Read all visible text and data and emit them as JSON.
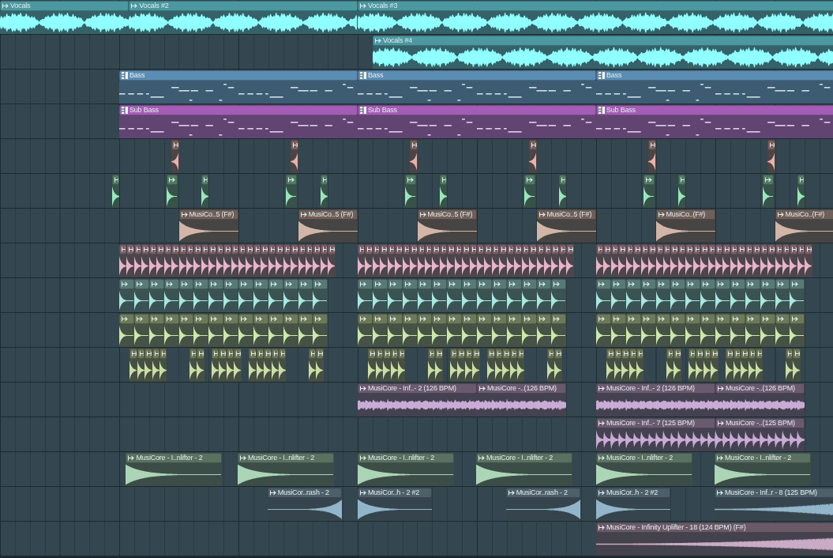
{
  "playlist": {
    "tracks": [
      {
        "color": "#4b98a0",
        "clips": [
          {
            "kind": "vocal",
            "label": "Vocals"
          },
          {
            "kind": "vocal",
            "label": "Vocals #2"
          },
          {
            "kind": "vocal",
            "label": "Vocals #3"
          }
        ]
      },
      {
        "color": "#4b98a0",
        "clips": [
          {
            "kind": "vocal",
            "label": "Vocals #4"
          }
        ]
      },
      {
        "color": "#5b8db3",
        "clips": [
          {
            "kind": "pattern",
            "label": "Bass"
          },
          {
            "kind": "pattern",
            "label": "Bass"
          },
          {
            "kind": "pattern",
            "label": "Bass"
          }
        ]
      },
      {
        "color": "#a35db4",
        "clips": [
          {
            "kind": "pattern",
            "label": "Sub Bass"
          },
          {
            "kind": "pattern",
            "label": "Sub Bass"
          },
          {
            "kind": "pattern",
            "label": "Sub Bass"
          }
        ]
      },
      {
        "color": "#7a5d5a",
        "clips": [
          {
            "kind": "swell"
          },
          {
            "kind": "swell"
          },
          {
            "kind": "swell"
          },
          {
            "kind": "swell"
          },
          {
            "kind": "swell"
          },
          {
            "kind": "swell"
          }
        ]
      },
      {
        "color": "#4f7a62",
        "clips": [
          {
            "kind": "decay"
          },
          {
            "kind": "decay"
          },
          {
            "kind": "decay"
          },
          {
            "kind": "decay"
          },
          {
            "kind": "decay"
          },
          {
            "kind": "decay"
          },
          {
            "kind": "decay"
          },
          {
            "kind": "decay"
          },
          {
            "kind": "decay"
          },
          {
            "kind": "decay"
          },
          {
            "kind": "decay"
          },
          {
            "kind": "decay"
          },
          {
            "kind": "decay"
          }
        ]
      },
      {
        "color": "#6e5f58",
        "clips": [
          {
            "kind": "decay",
            "label": "MusiCo..5 (F#)"
          },
          {
            "kind": "decay",
            "label": "MusiCo..5 (F#)"
          },
          {
            "kind": "decay",
            "label": "MusiCo..5 (F#)"
          },
          {
            "kind": "decay",
            "label": "MusiCo..5 (F#)"
          },
          {
            "kind": "decay",
            "label": "MusiCo..(F#)"
          },
          {
            "kind": "decay",
            "label": "MusiCo..(F#)"
          }
        ]
      },
      {
        "color": "#7a5f68",
        "clips": [
          {
            "kind": "stutter"
          },
          {
            "kind": "stutter"
          },
          {
            "kind": "stutter"
          }
        ]
      },
      {
        "color": "#587a76",
        "clips": [
          {
            "kind": "hits"
          },
          {
            "kind": "hits"
          },
          {
            "kind": "hits"
          }
        ]
      },
      {
        "color": "#6c7a5a",
        "clips": [
          {
            "kind": "hits"
          },
          {
            "kind": "hits"
          },
          {
            "kind": "hits"
          }
        ]
      },
      {
        "color": "#6b7556",
        "clips": [
          {
            "kind": "stutter"
          },
          {
            "kind": "stutter"
          },
          {
            "kind": "stutter"
          },
          {
            "kind": "stutter"
          },
          {
            "kind": "stutter"
          },
          {
            "kind": "stutter"
          },
          {
            "kind": "stutter"
          },
          {
            "kind": "stutter"
          },
          {
            "kind": "stutter"
          },
          {
            "kind": "stutter"
          },
          {
            "kind": "stutter"
          },
          {
            "kind": "stutter"
          },
          {
            "kind": "stutter"
          },
          {
            "kind": "stutter"
          },
          {
            "kind": "stutter"
          }
        ]
      },
      {
        "color": "#6a5a70",
        "clips": [
          {
            "kind": "noise",
            "label": "MusiCore - Inf..- 2 (126 BPM)"
          },
          {
            "kind": "noise",
            "label": "MusiCore -..(126 BPM)"
          },
          {
            "kind": "noise",
            "label": "MusiCore - Inf..- 2 (126 BPM)"
          },
          {
            "kind": "noise",
            "label": "MusiCore -..(126 BPM)"
          }
        ]
      },
      {
        "color": "#6a5a70",
        "clips": [
          {
            "kind": "pulse",
            "label": "MusiCore - Inf..- 7 (125 BPM)"
          },
          {
            "kind": "pulse",
            "label": "MusiCore -..(125 BPM)"
          }
        ]
      },
      {
        "color": "#5a7060",
        "clips": [
          {
            "kind": "decay",
            "label": "MusiCore - I..nlifter - 2"
          },
          {
            "kind": "decay",
            "label": "MusiCore - I..nlifter - 2"
          },
          {
            "kind": "decay",
            "label": "MusiCore - I..nlifter - 2"
          },
          {
            "kind": "decay",
            "label": "MusiCore - I..nlifter - 2"
          },
          {
            "kind": "decay",
            "label": "MusiCore - I..nlifter - 2"
          },
          {
            "kind": "decay",
            "label": "MusiCore - I..nlifter - 2"
          }
        ]
      },
      {
        "color": "#4d5f6a",
        "clips": [
          {
            "kind": "swell",
            "label": "MusiCor..rash - 2"
          },
          {
            "kind": "decay",
            "label": "MusiCor..h - 2 #2"
          },
          {
            "kind": "swell",
            "label": "MusiCor..rash - 2"
          },
          {
            "kind": "decay",
            "label": "MusiCor..h - 2 #2"
          },
          {
            "kind": "riser",
            "label": "MusiCore - Inf..r - 8 (125 BPM)"
          }
        ]
      },
      {
        "color": "#6a5a68",
        "clips": [
          {
            "kind": "riser",
            "label": "MusiCore - Infinity Uplifter - 18 (124 BPM) (F#)"
          }
        ]
      }
    ]
  }
}
